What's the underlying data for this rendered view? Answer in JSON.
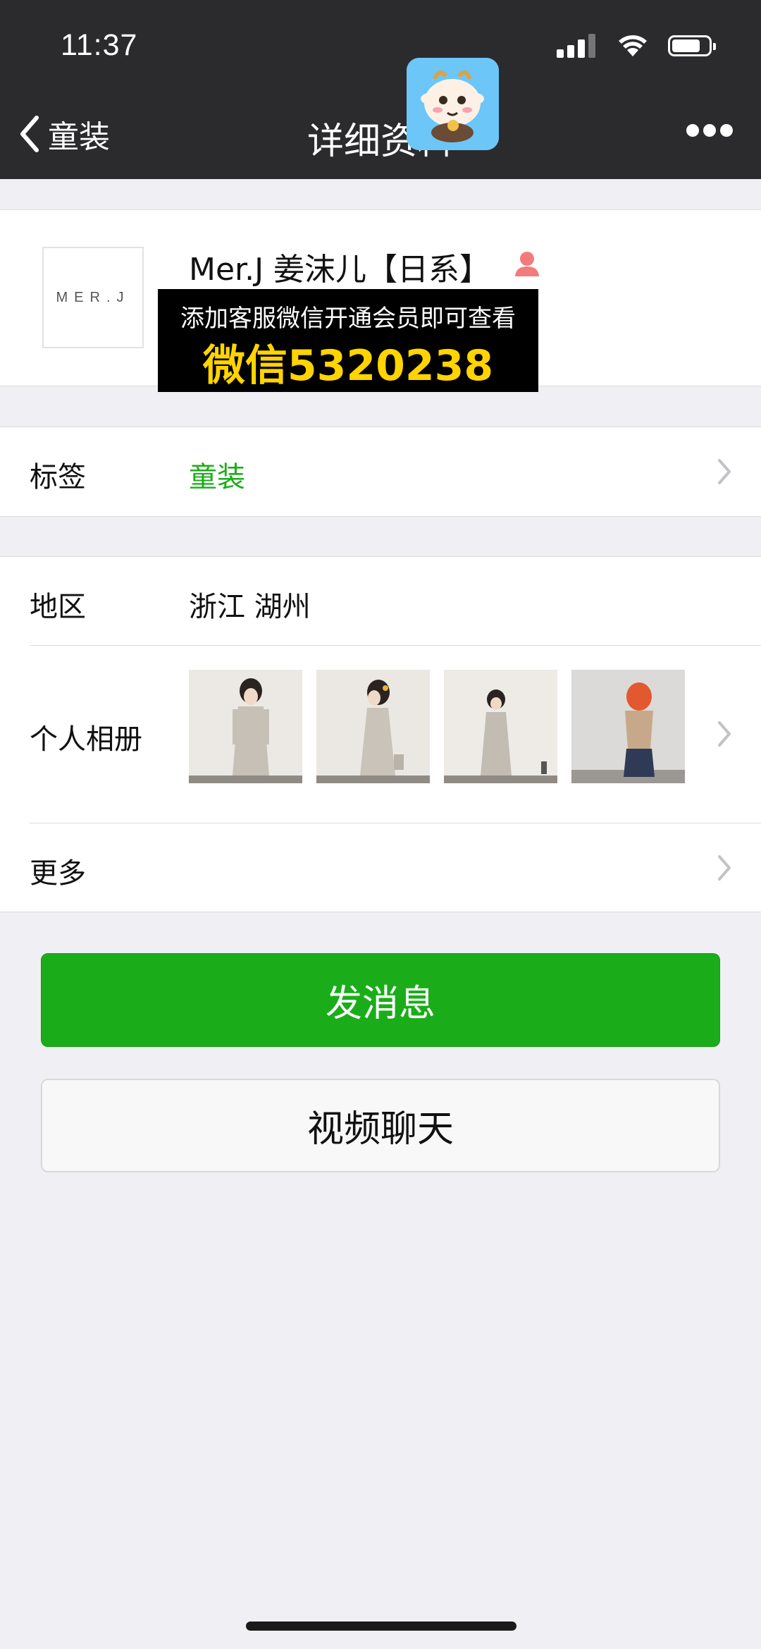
{
  "status_bar": {
    "time": "11:37"
  },
  "nav": {
    "back_label": "童装",
    "title": "详细资料"
  },
  "profile": {
    "avatar_text": "MER.J",
    "name": "Mer.J 姜沫儿【日系】",
    "promo_line1": "添加客服微信开通会员即可查看",
    "promo_line2": "微信5320238"
  },
  "tag_row": {
    "label": "标签",
    "value": "童装",
    "value_color": "#1aad19"
  },
  "region_row": {
    "label": "地区",
    "value": "浙江 湖州"
  },
  "album_row": {
    "label": "个人相册",
    "photos": [
      "girl-dress-front",
      "girl-dress-side",
      "girl-dress-full",
      "girl-red-hair-sweater"
    ]
  },
  "more_row": {
    "label": "更多"
  },
  "buttons": {
    "send_message": "发消息",
    "video_call": "视频聊天"
  }
}
